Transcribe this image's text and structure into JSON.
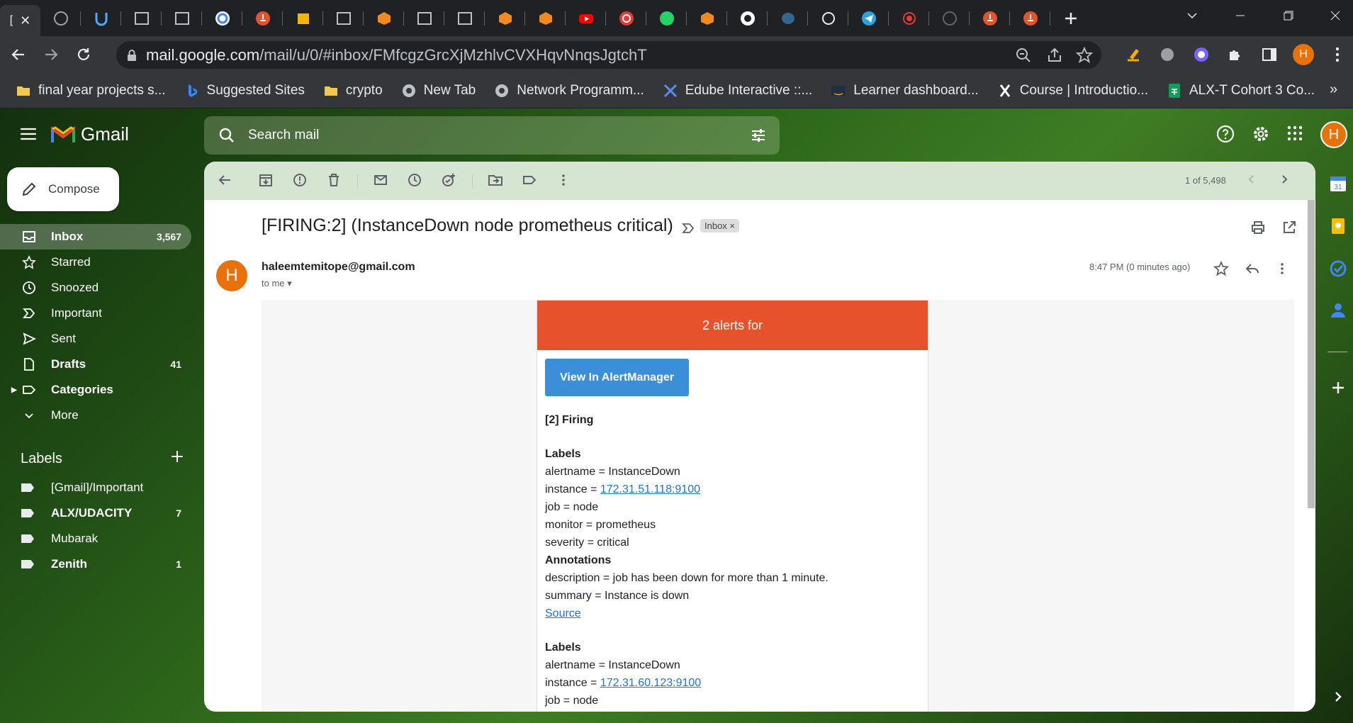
{
  "browser": {
    "url_host": "mail.google.com",
    "url_path": "/mail/u/0/#inbox/FMfcgzGrcXjMzhlvCVXHqvNnqsJgtchT",
    "active_tab_label": "[",
    "bookmarks": [
      {
        "label": "final year projects s...",
        "icon": "folder-icon"
      },
      {
        "label": "Suggested Sites",
        "icon": "bing-icon"
      },
      {
        "label": "crypto",
        "icon": "folder-icon"
      },
      {
        "label": "New Tab",
        "icon": "globe-icon"
      },
      {
        "label": "Network Programm...",
        "icon": "globe-icon"
      },
      {
        "label": "Edube Interactive ::...",
        "icon": "edube-icon"
      },
      {
        "label": "Learner dashboard...",
        "icon": "aws-icon"
      },
      {
        "label": "Course | Introductio...",
        "icon": "x-icon"
      },
      {
        "label": "ALX-T Cohort 3 Co...",
        "icon": "sheets-icon"
      }
    ],
    "profile_initial": "H"
  },
  "gmail": {
    "logo_text": "Gmail",
    "search_placeholder": "Search mail",
    "avatar_initial": "H",
    "compose_label": "Compose",
    "nav": [
      {
        "label": "Inbox",
        "count": "3,567",
        "icon": "inbox-icon"
      },
      {
        "label": "Starred",
        "count": "",
        "icon": "star-icon"
      },
      {
        "label": "Snoozed",
        "count": "",
        "icon": "clock-icon"
      },
      {
        "label": "Important",
        "count": "",
        "icon": "important-icon"
      },
      {
        "label": "Sent",
        "count": "",
        "icon": "send-icon"
      },
      {
        "label": "Drafts",
        "count": "41",
        "icon": "draft-icon"
      },
      {
        "label": "Categories",
        "count": "",
        "icon": "label-outline-icon"
      },
      {
        "label": "More",
        "count": "",
        "icon": "chevron-down-icon"
      }
    ],
    "labels_heading": "Labels",
    "labels": [
      {
        "label": "[Gmail]/Important",
        "count": ""
      },
      {
        "label": "ALX/UDACITY",
        "count": "7"
      },
      {
        "label": "Mubarak",
        "count": ""
      },
      {
        "label": "Zenith",
        "count": "1"
      }
    ],
    "pager": "1 of 5,498",
    "subject": "[FIRING:2] (InstanceDown node prometheus critical)",
    "inbox_chip": "Inbox ×",
    "sender": "haleemtemitope@gmail.com",
    "sender_initial": "H",
    "to_me": "to me",
    "time": "8:47 PM (0 minutes ago)"
  },
  "alert": {
    "banner": "2 alerts for",
    "button": "View In AlertManager",
    "firing": "[2] Firing",
    "labels_title": "Labels",
    "alertname1": "alertname = InstanceDown",
    "instance_prefix": "instance = ",
    "instance1": "172.31.51.118:9100",
    "job1": "job = node",
    "monitor1": "monitor = prometheus",
    "severity1": "severity = critical",
    "annotations_title": "Annotations",
    "description1": "description = job has been down for more than 1 minute.",
    "summary1": "summary = Instance is down",
    "source": "Source",
    "labels_title2": "Labels",
    "alertname2": "alertname = InstanceDown",
    "instance2": "172.31.60.123:9100",
    "job2": "job = node"
  },
  "colors": {
    "alert_banner": "#e6522c",
    "alertmanager_button": "#3b8fd9",
    "avatar": "#e8710a"
  }
}
